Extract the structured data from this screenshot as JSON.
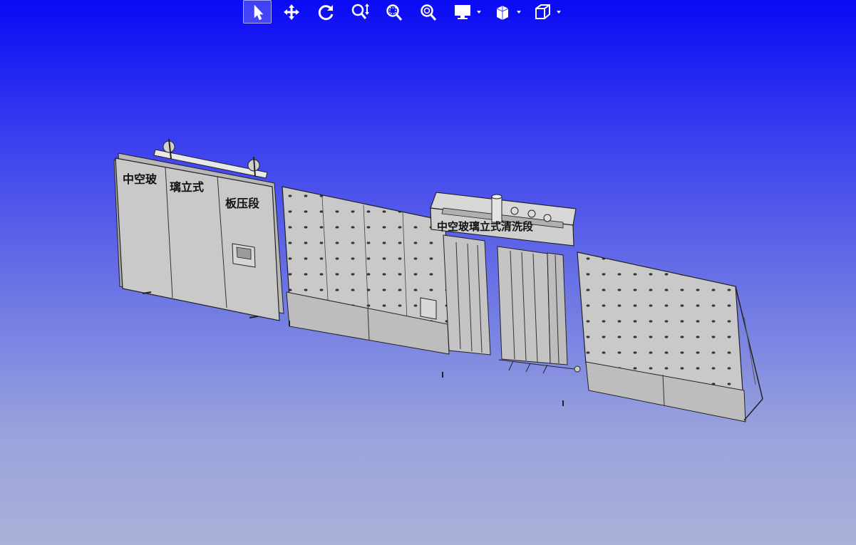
{
  "toolbar": {
    "items": [
      {
        "icon": "select-arrow-icon",
        "active": true
      },
      {
        "icon": "pan-move-icon"
      },
      {
        "icon": "rotate-icon"
      },
      {
        "icon": "zoom-icon"
      },
      {
        "icon": "zoom-window-icon"
      },
      {
        "icon": "zoom-fit-icon"
      },
      {
        "icon": "display-mode-icon",
        "dropdown": true
      },
      {
        "icon": "section-view-icon",
        "dropdown": true
      },
      {
        "icon": "view-cube-icon",
        "dropdown": true
      }
    ]
  },
  "model": {
    "press_section_label_1": "中空玻",
    "press_section_label_2": "璃立式",
    "press_section_label_3": "板压段",
    "washer_section_label": "中空玻璃立式清洗段"
  },
  "colors": {
    "background_top": "#0a0af4",
    "background_bottom": "#aab0d8",
    "model_gray": "#c8c8c8"
  }
}
